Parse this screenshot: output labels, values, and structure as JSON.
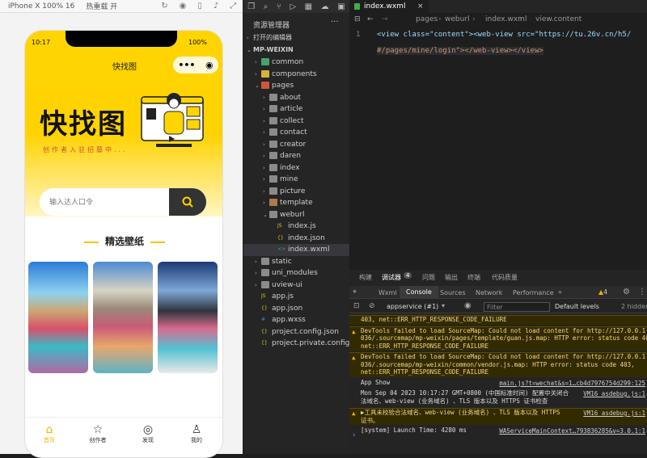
{
  "sim_toolbar": {
    "device": "iPhone X 100% 16",
    "hotreload": "热重载 开"
  },
  "phone": {
    "time": "10:17",
    "battery": "100%",
    "nav_title": "快找图",
    "capsule_more": "•••",
    "capsule_close": "◉",
    "hero_title": "快找图",
    "hero_subtitle": "创作者入驻招募中...",
    "search_placeholder": "输入达人口令",
    "section_title": "精选壁纸",
    "tabs": [
      {
        "label": "首页",
        "icon": "⌂"
      },
      {
        "label": "创作者",
        "icon": "☆"
      },
      {
        "label": "发现",
        "icon": "◎"
      },
      {
        "label": "我的",
        "icon": "♙"
      }
    ]
  },
  "explorer": {
    "title": "资源管理器",
    "menu": "···",
    "open_editors": "打开的编辑器",
    "root": "MP-WEIXIN",
    "items": [
      {
        "label": "common",
        "type": "folder-green"
      },
      {
        "label": "components",
        "type": "folder-yellow"
      },
      {
        "label": "pages",
        "type": "folder-red"
      },
      {
        "label": "about",
        "type": "folder"
      },
      {
        "label": "article",
        "type": "folder"
      },
      {
        "label": "collect",
        "type": "folder"
      },
      {
        "label": "contact",
        "type": "folder"
      },
      {
        "label": "creator",
        "type": "folder"
      },
      {
        "label": "daren",
        "type": "folder"
      },
      {
        "label": "index",
        "type": "folder"
      },
      {
        "label": "mine",
        "type": "folder"
      },
      {
        "label": "picture",
        "type": "folder"
      },
      {
        "label": "template",
        "type": "folder-brown"
      },
      {
        "label": "weburl",
        "type": "folder"
      },
      {
        "label": "index.js",
        "type": "js"
      },
      {
        "label": "index.json",
        "type": "json"
      },
      {
        "label": "index.wxml",
        "type": "wxml"
      },
      {
        "label": "static",
        "type": "folder"
      },
      {
        "label": "uni_modules",
        "type": "folder"
      },
      {
        "label": "uview-ui",
        "type": "folder"
      },
      {
        "label": "app.js",
        "type": "js"
      },
      {
        "label": "app.json",
        "type": "json"
      },
      {
        "label": "app.wxss",
        "type": "css"
      },
      {
        "label": "project.config.json",
        "type": "json"
      },
      {
        "label": "project.private.config.js...",
        "type": "json"
      }
    ]
  },
  "editor": {
    "tab": "index.wxml",
    "breadcrumb": [
      "pages",
      "weburl",
      "index.wxml",
      "view.content"
    ],
    "line1_no": "1",
    "line1": "<view class=\"content\"><web-view src=\"https://tu.26v.cn/h5/",
    "line2": "#/pages/mine/login\"></web-view></view>"
  },
  "devtools": {
    "top_tabs": [
      "构建",
      "调试器",
      "问题",
      "输出",
      "终端",
      "代码质量"
    ],
    "badge": "4",
    "panels": [
      "Wxml",
      "Console",
      "Sources",
      "Network",
      "Performance",
      "»"
    ],
    "warn_count": "4",
    "context": "appservice (#1)",
    "filter_placeholder": "Filter",
    "levels": "Default levels",
    "hidden": "2 hidden",
    "logs": [
      {
        "kind": "warn",
        "text": "403, net::ERR_HTTP_RESPONSE_CODE_FAILURE",
        "link": ""
      },
      {
        "kind": "warn",
        "text": "DevTools failed to load SourceMap: Could not load content for http://127.0.0.1:65",
        "text2": "036/.sourcemap/mp-weixin/pages/template/guan.js.map: HTTP error: status code 403,",
        "text3": "net::ERR_HTTP_RESPONSE_CODE_FAILURE"
      },
      {
        "kind": "warn",
        "text": "DevTools failed to load SourceMap: Could not load content for http://127.0.0.1:65",
        "text2": "036/.sourcemap/mp-weixin/common/vendor.js.map: HTTP error: status code 403,",
        "text3": "net::ERR_HTTP_RESPONSE_CODE_FAILURE"
      },
      {
        "kind": "info",
        "text": "App Show",
        "link": "main.js?t=wechat&s=1…cb4d7976754d299:125"
      },
      {
        "kind": "info",
        "text": "Mon Sep 04 2023 10:17:27 GMT+0800 (中国标准时间) 配置中关闭合",
        "text2": "法域名、web-view (业务域名) 、TLS 版本以及 HTTPS 证书检查",
        "link": "VM16 asdebug.js:1"
      },
      {
        "kind": "warn",
        "text": "▶工具未校验合法域名、web-view (业务域名) 、TLS 版本以及 HTTPS",
        "text2": "证书。",
        "link": "VM16 asdebug.js:1"
      },
      {
        "kind": "info",
        "text": "[system] Launch Time: 4280 ms",
        "link": "WAServiceMainContext…793836285&v=3.0.1:1"
      }
    ]
  },
  "colors": {
    "accent": "#ffd500",
    "editor_bg": "#1e1e1e",
    "warn_bg": "#332b00"
  }
}
